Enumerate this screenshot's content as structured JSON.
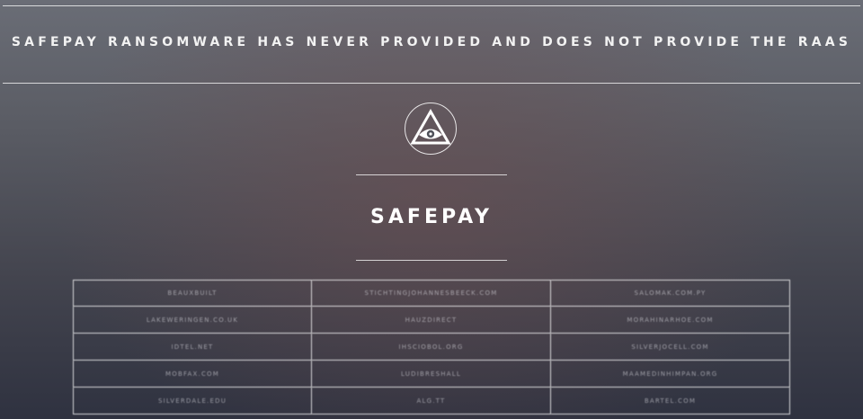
{
  "banner": {
    "text": "SAFEPAY RANSOMWARE HAS NEVER PROVIDED AND DOES NOT PROVIDE THE RAAS"
  },
  "logo": {
    "icon": "eye-in-triangle-icon"
  },
  "site": {
    "title": "SAFEPAY"
  },
  "victims": {
    "rows": [
      [
        "beauxbuilt",
        "stichtingjohannesbeeck.com",
        "salomak.com.py"
      ],
      [
        "lakeweringen.co.uk",
        "hauzdirect",
        "morahinarhoe.com"
      ],
      [
        "idtel.net",
        "ihsciobol.org",
        "silverjocell.com"
      ],
      [
        "mobfax.com",
        "ludibreshall",
        "maamedinhimpan.org"
      ],
      [
        "silverdale.edu",
        "alg.tt",
        "bartel.com"
      ]
    ]
  },
  "colors": {
    "text": "#ffffff",
    "rule": "#d8d8dc",
    "background_top": "#6a6d76",
    "background_bottom": "#2f3240"
  }
}
